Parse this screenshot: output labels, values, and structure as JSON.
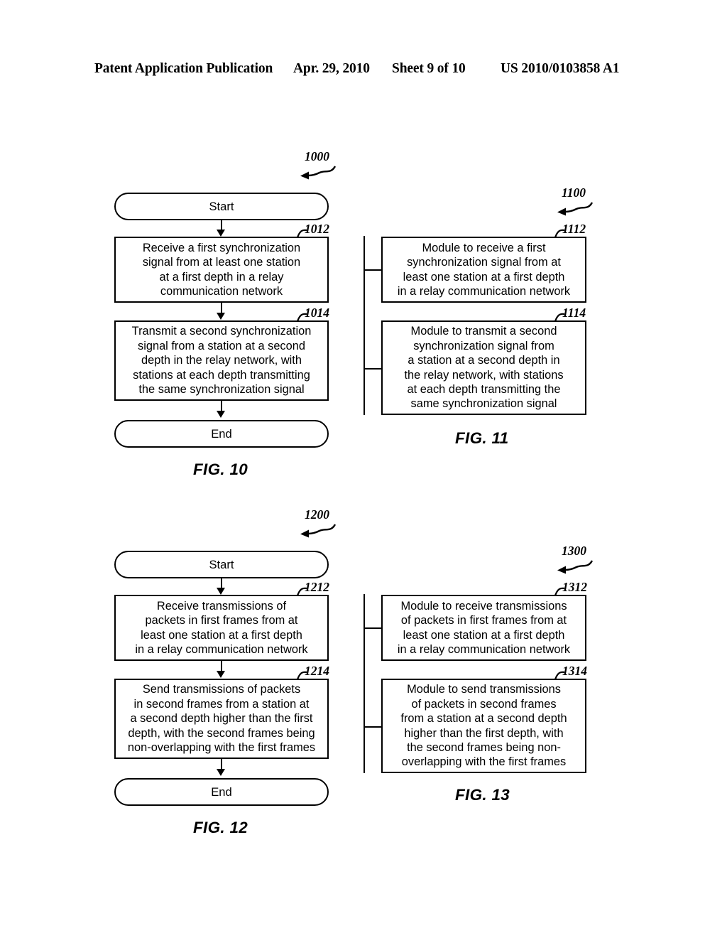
{
  "header": {
    "publication": "Patent Application Publication",
    "date": "Apr. 29, 2010",
    "sheet": "Sheet 9 of 10",
    "patent_number": "US 2010/0103858 A1"
  },
  "figures": [
    {
      "id": "fig10",
      "caption": "FIG. 10",
      "diagram_ref": "1000",
      "type": "flowchart",
      "nodes": [
        {
          "ref": "",
          "kind": "terminator",
          "text": "Start"
        },
        {
          "ref": "1012",
          "kind": "process",
          "text": "Receive a first synchronization signal from at least one station at a first depth in a relay communication network"
        },
        {
          "ref": "1014",
          "kind": "process",
          "text": "Transmit a second synchronization signal from a station at a second depth in the relay network, with stations at each depth transmitting the same synchronization signal"
        },
        {
          "ref": "",
          "kind": "terminator",
          "text": "End"
        }
      ]
    },
    {
      "id": "fig11",
      "caption": "FIG. 11",
      "diagram_ref": "1100",
      "type": "module-bracket",
      "nodes": [
        {
          "ref": "1112",
          "kind": "module",
          "text": "Module to receive a first synchronization signal from at least one station at a first depth in a relay communication network"
        },
        {
          "ref": "1114",
          "kind": "module",
          "text": "Module to transmit a second synchronization signal from a station at a second depth in the relay network, with stations at each depth transmitting the same synchronization signal"
        }
      ]
    },
    {
      "id": "fig12",
      "caption": "FIG. 12",
      "diagram_ref": "1200",
      "type": "flowchart",
      "nodes": [
        {
          "ref": "",
          "kind": "terminator",
          "text": "Start"
        },
        {
          "ref": "1212",
          "kind": "process",
          "text": "Receive transmissions of packets in first frames from at least one station at a first depth in a relay communication network"
        },
        {
          "ref": "1214",
          "kind": "process",
          "text": "Send transmissions of packets in second frames from a station at a second depth higher than the first depth, with the second frames being non-overlapping with the first frames"
        },
        {
          "ref": "",
          "kind": "terminator",
          "text": "End"
        }
      ]
    },
    {
      "id": "fig13",
      "caption": "FIG. 13",
      "diagram_ref": "1300",
      "type": "module-bracket",
      "nodes": [
        {
          "ref": "1312",
          "kind": "module",
          "text": "Module to receive transmissions of packets in first frames from at least one station at a first depth in a relay communication network"
        },
        {
          "ref": "1314",
          "kind": "module",
          "text": "Module to send transmissions of packets in second frames from a station at a second depth higher than the first depth, with the second frames being non-overlapping with the first frames"
        }
      ]
    }
  ],
  "fig10_lines": {
    "start": "Start",
    "end": "End",
    "box1012": "Receive a first synchronization\nsignal from at least one station\nat a first depth in a relay\ncommunication network",
    "box1014": "Transmit a second synchronization\nsignal from a station at a second\ndepth in the relay network, with\nstations at each depth transmitting\nthe same synchronization signal"
  },
  "fig11_lines": {
    "box1112": "Module to receive a first\nsynchronization signal from at\nleast one station at a first depth\nin a relay communication network",
    "box1114": "Module to transmit a second\nsynchronization signal from\na station at a second depth in\nthe relay network, with stations\nat each depth transmitting the\nsame synchronization signal"
  },
  "fig12_lines": {
    "start": "Start",
    "end": "End",
    "box1212": "Receive transmissions of\npackets in first frames from at\nleast one station at a first depth\nin a relay communication network",
    "box1214": "Send transmissions of packets\nin second frames from a station at\na second depth higher than the first\ndepth, with the second frames being\nnon-overlapping with the first frames"
  },
  "fig13_lines": {
    "box1312": "Module to receive transmissions\nof packets in first frames from at\nleast one station at a first depth\nin a relay communication network",
    "box1314": "Module to send transmissions\nof packets in second frames\nfrom a station at a second depth\nhigher than the first depth, with\nthe second frames being non-\noverlapping with the first frames"
  },
  "refs": {
    "r1000": "1000",
    "r1012": "1012",
    "r1014": "1014",
    "r1100": "1100",
    "r1112": "1112",
    "r1114": "1114",
    "r1200": "1200",
    "r1212": "1212",
    "r1214": "1214",
    "r1300": "1300",
    "r1312": "1312",
    "r1314": "1314"
  },
  "captions": {
    "fig10": "FIG. 10",
    "fig11": "FIG. 11",
    "fig12": "FIG. 12",
    "fig13": "FIG. 13"
  }
}
